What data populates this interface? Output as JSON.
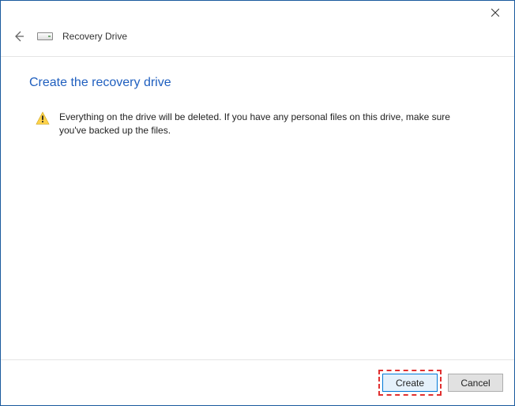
{
  "header": {
    "title": "Recovery Drive"
  },
  "page": {
    "heading": "Create the recovery drive",
    "warning_text": "Everything on the drive will be deleted. If you have any personal files on this drive, make sure you've backed up the files."
  },
  "footer": {
    "create_label": "Create",
    "cancel_label": "Cancel"
  }
}
